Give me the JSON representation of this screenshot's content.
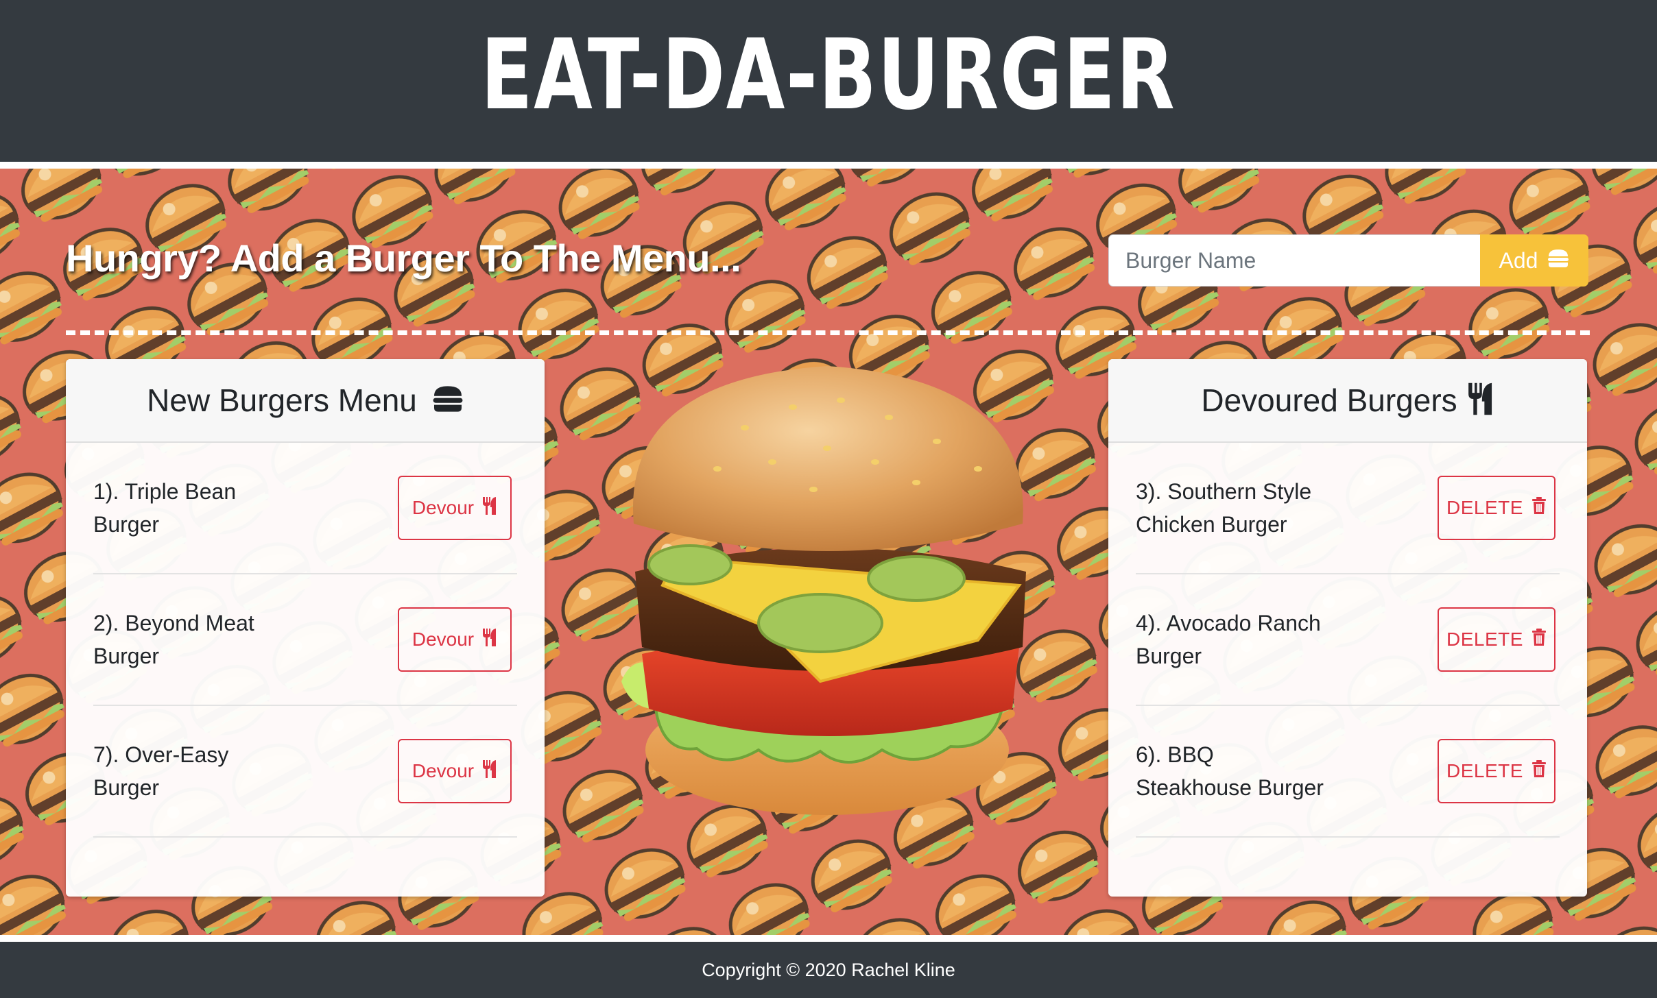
{
  "header": {
    "title": "EAT-DA-BURGER"
  },
  "add_section": {
    "headline": "Hungry? Add a Burger To The Menu...",
    "input_placeholder": "Burger Name",
    "input_value": "",
    "add_label": "Add"
  },
  "new_burgers": {
    "title": "New Burgers Menu",
    "items": [
      {
        "line1": "1). Triple Bean",
        "line2": "Burger",
        "button": "Devour"
      },
      {
        "line1": "2). Beyond Meat",
        "line2": "Burger",
        "button": "Devour"
      },
      {
        "line1": "7). Over-Easy",
        "line2": "Burger",
        "button": "Devour"
      }
    ]
  },
  "devoured_burgers": {
    "title": "Devoured Burgers",
    "items": [
      {
        "line1": "3). Southern Style",
        "line2": "Chicken Burger",
        "button": "DELETE"
      },
      {
        "line1": "4). Avocado Ranch",
        "line2": "Burger",
        "button": "DELETE"
      },
      {
        "line1": "6). BBQ",
        "line2": "Steakhouse Burger",
        "button": "DELETE"
      }
    ]
  },
  "footer": {
    "copyright": "Copyright © 2020 Rachel Kline"
  },
  "icons": {
    "add_button": "hamburger-icon",
    "new_menu": "hamburger-icon",
    "devoured": "utensils-icon",
    "devour_button": "utensils-icon",
    "delete_button": "trash-icon"
  },
  "colors": {
    "header_bg": "#343a40",
    "main_bg": "#dc6f5f",
    "accent_yellow": "#f7c23a",
    "danger": "#dc3545"
  }
}
